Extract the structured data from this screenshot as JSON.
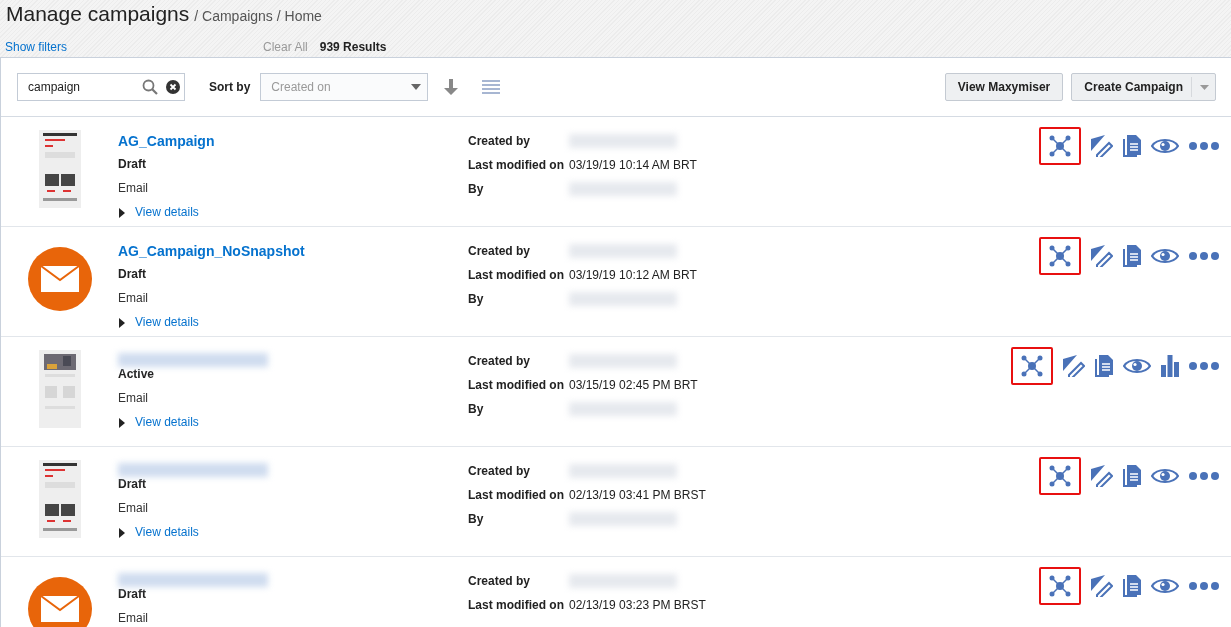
{
  "header": {
    "title": "Manage campaigns",
    "breadcrumb": "/ Campaigns / Home"
  },
  "filter_bar": {
    "show_filters": "Show filters",
    "clear_all": "Clear All",
    "results": "939 Results"
  },
  "toolbar": {
    "search": {
      "value": "campaign"
    },
    "sort_label": "Sort by",
    "sort": {
      "placeholder": "Created on"
    },
    "buttons": [
      {
        "label": "View Maxymiser",
        "kind": "plain"
      },
      {
        "label": "Create Campaign",
        "kind": "split"
      }
    ]
  },
  "campaigns": [
    {
      "kind": "snapshot",
      "name": "AG_Campaign",
      "status": "Draft",
      "type": "Email",
      "details": "View details",
      "created_by_label": "Created by",
      "modified_label": "Last modified on",
      "modified": "03/19/19 10:14 AM BRT",
      "by_label": "By",
      "actions": [
        {
          "kind": "network",
          "highlighted": true
        },
        {
          "kind": "edit",
          "highlighted": false
        },
        {
          "kind": "copy",
          "highlighted": false
        },
        {
          "kind": "view",
          "highlighted": false
        },
        {
          "kind": "more",
          "highlighted": false
        }
      ]
    },
    {
      "kind": "envelope",
      "name": "AG_Campaign_NoSnapshot",
      "status": "Draft",
      "type": "Email",
      "details": "View details",
      "created_by_label": "Created by",
      "modified_label": "Last modified on",
      "modified": "03/19/19 10:12 AM BRT",
      "by_label": "By",
      "actions": [
        {
          "kind": "network",
          "highlighted": true
        },
        {
          "kind": "edit",
          "highlighted": false
        },
        {
          "kind": "copy",
          "highlighted": false
        },
        {
          "kind": "view",
          "highlighted": false
        },
        {
          "kind": "more",
          "highlighted": false
        }
      ]
    },
    {
      "kind": "photo-snapshot",
      "status": "Active",
      "type": "Email",
      "details": "View details",
      "created_by_label": "Created by",
      "modified_label": "Last modified on",
      "modified": "03/15/19 02:45 PM BRT",
      "by_label": "By",
      "actions": [
        {
          "kind": "network",
          "highlighted": true
        },
        {
          "kind": "edit",
          "highlighted": false
        },
        {
          "kind": "copy",
          "highlighted": false
        },
        {
          "kind": "view",
          "highlighted": false
        },
        {
          "kind": "chart",
          "highlighted": false
        },
        {
          "kind": "more",
          "highlighted": false
        }
      ]
    },
    {
      "kind": "snapshot",
      "status": "Draft",
      "type": "Email",
      "details": "View details",
      "created_by_label": "Created by",
      "modified_label": "Last modified on",
      "modified": "02/13/19 03:41 PM BRST",
      "by_label": "By",
      "actions": [
        {
          "kind": "network",
          "highlighted": true
        },
        {
          "kind": "edit",
          "highlighted": false
        },
        {
          "kind": "copy",
          "highlighted": false
        },
        {
          "kind": "view",
          "highlighted": false
        },
        {
          "kind": "more",
          "highlighted": false
        }
      ]
    },
    {
      "kind": "envelope",
      "status": "Draft",
      "type": "Email",
      "created_by_label": "Created by",
      "modified_label": "Last modified on",
      "modified": "02/13/19 03:23 PM BRST",
      "actions": [
        {
          "kind": "network",
          "highlighted": true
        },
        {
          "kind": "edit",
          "highlighted": false
        },
        {
          "kind": "copy",
          "highlighted": false
        },
        {
          "kind": "view",
          "highlighted": false
        },
        {
          "kind": "more",
          "highlighted": false
        }
      ]
    }
  ]
}
